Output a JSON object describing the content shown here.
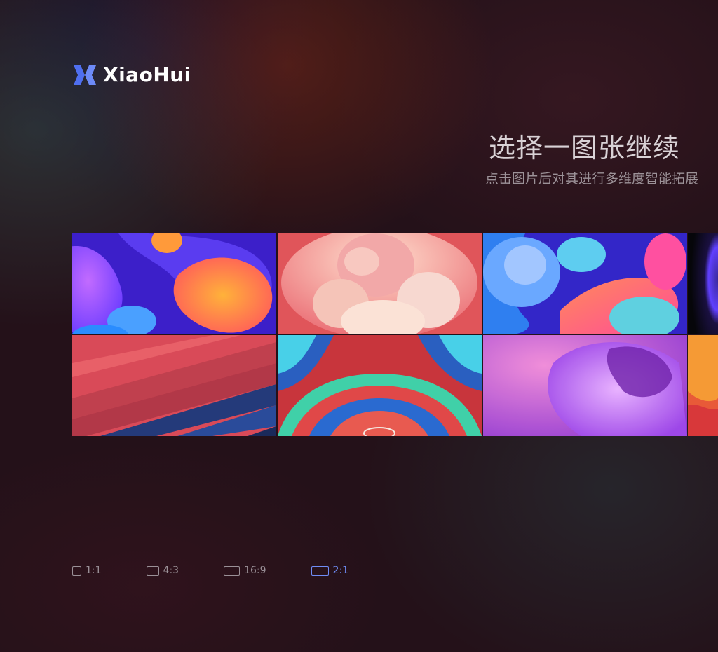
{
  "brand": {
    "name": "XiaoHui",
    "logo_icon": "xiaohui-logo-icon",
    "accent": "#4f6ff0"
  },
  "header": {
    "title": "选择一图张继续",
    "subtitle": "点击图片后对其进行多维度智能拓展"
  },
  "gallery": {
    "images": [
      {
        "name": "gallery-image-1",
        "theme": "blue-orange-blobs"
      },
      {
        "name": "gallery-image-2",
        "theme": "pink-swirl"
      },
      {
        "name": "gallery-image-3",
        "theme": "blue-purple-blobs"
      },
      {
        "name": "gallery-image-4",
        "theme": "dark-purple-glow"
      },
      {
        "name": "gallery-image-5",
        "theme": "red-diagonal-stripes"
      },
      {
        "name": "gallery-image-6",
        "theme": "teal-red-waves"
      },
      {
        "name": "gallery-image-7",
        "theme": "magenta-gradient"
      },
      {
        "name": "gallery-image-8",
        "theme": "orange-red"
      }
    ]
  },
  "aspect_ratios": {
    "selected": "2:1",
    "active_color": "#6f8cf5",
    "options": [
      {
        "label": "1:1"
      },
      {
        "label": "4:3"
      },
      {
        "label": "16:9"
      },
      {
        "label": "2:1"
      }
    ]
  }
}
